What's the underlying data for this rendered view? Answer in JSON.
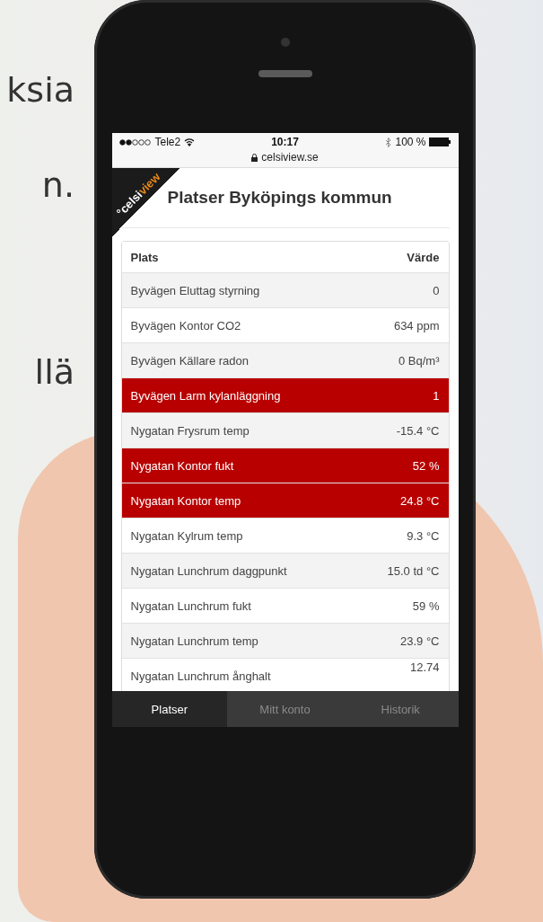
{
  "background_text": [
    "ksia",
    "n.",
    "llä"
  ],
  "status_bar": {
    "carrier": "Tele2",
    "time": "10:17",
    "battery": "100 %",
    "url": "celsiview.se"
  },
  "logo": [
    "°celsi",
    "view"
  ],
  "page_title": "Platser Byköpings kommun",
  "table": {
    "columns": [
      "Plats",
      "Värde"
    ],
    "rows": [
      {
        "place": "Byvägen Eluttag styrning",
        "value": "0",
        "alarm": false
      },
      {
        "place": "Byvägen Kontor CO2",
        "value": "634 ppm",
        "alarm": false
      },
      {
        "place": "Byvägen Källare radon",
        "value": "0 Bq/m³",
        "alarm": false
      },
      {
        "place": "Byvägen Larm kylanläggning",
        "value": "1",
        "alarm": true
      },
      {
        "place": "Nygatan Frysrum temp",
        "value": "-15.4 °C",
        "alarm": false
      },
      {
        "place": "Nygatan Kontor fukt",
        "value": "52 %",
        "alarm": true
      },
      {
        "place": "Nygatan Kontor temp",
        "value": "24.8 °C",
        "alarm": true
      },
      {
        "place": "Nygatan Kylrum temp",
        "value": "9.3 °C",
        "alarm": false
      },
      {
        "place": "Nygatan Lunchrum daggpunkt",
        "value": "15.0 td °C",
        "alarm": false
      },
      {
        "place": "Nygatan Lunchrum fukt",
        "value": "59 %",
        "alarm": false
      },
      {
        "place": "Nygatan Lunchrum temp",
        "value": "23.9 °C",
        "alarm": false
      },
      {
        "place": "Nygatan Lunchrum ånghalt",
        "value": "12.74",
        "alarm": false
      }
    ]
  },
  "tabs": [
    {
      "label": "Platser",
      "selected": true
    },
    {
      "label": "Mitt konto",
      "selected": false
    },
    {
      "label": "Historik",
      "selected": false
    }
  ]
}
